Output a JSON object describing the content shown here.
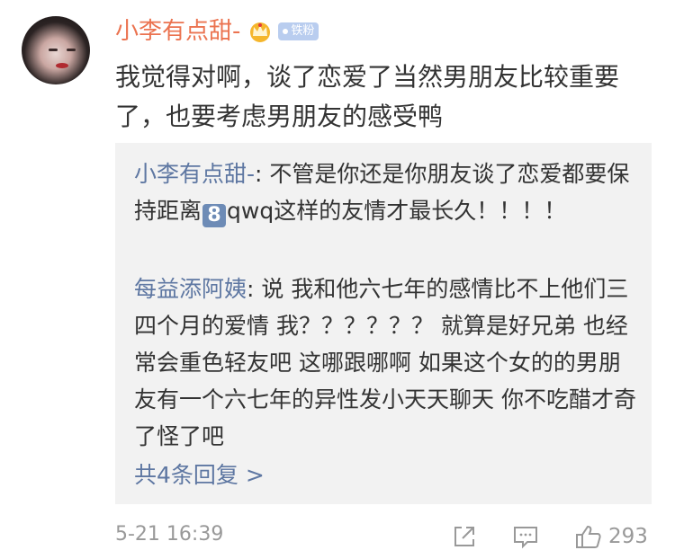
{
  "comment": {
    "username": "小李有点甜-",
    "badge": "铁粉",
    "text": "我觉得对啊，谈了恋爱了当然男朋友比较重要了，也要考虑男朋友的感受鸭"
  },
  "replies": [
    {
      "user": "小李有点甜-",
      "separator": ": ",
      "text_before": "不管是你还是你朋友谈了恋爱都要保持距离",
      "emoji": "8",
      "text_after": "qwq这样的友情才最长久！！！！"
    },
    {
      "user": "每益添阿姨",
      "separator": ": ",
      "text": "说 我和他六七年的感情比不上他们三四个月的爱情 我？？？？？？ 就算是好兄弟 也经常会重色轻友吧 这哪跟哪啊 如果这个女的的男朋友有一个六七年的异性发小天天聊天 你不吃醋才奇了怪了吧"
    }
  ],
  "more_replies": "共4条回复 >",
  "footer": {
    "time": "5-21 16:39",
    "likes": "293"
  },
  "icons": [
    "crown-icon",
    "share-icon",
    "comment-icon",
    "thumbs-up-icon"
  ],
  "colors": {
    "username": "#eb7350",
    "link": "#5e77a2",
    "reply_bg": "#f2f2f2",
    "badge": "#b9cdef"
  }
}
